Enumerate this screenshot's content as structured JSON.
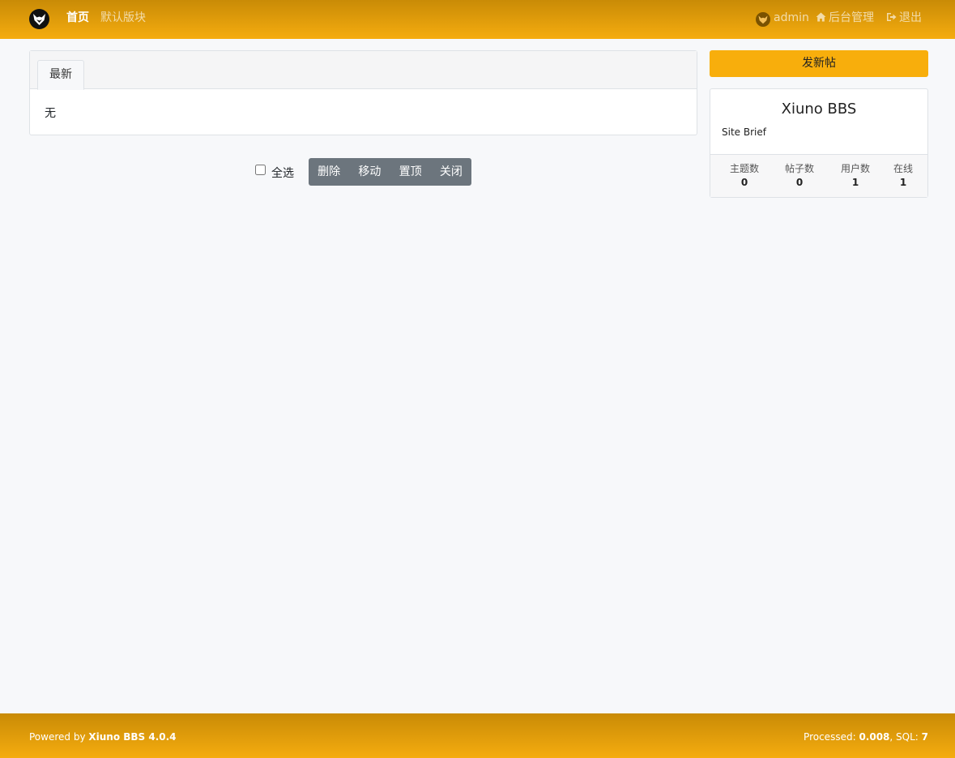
{
  "header": {
    "nav": {
      "home": "首页",
      "default_forum": "默认版块"
    },
    "user": {
      "name": "admin",
      "admin_panel": "后台管理",
      "logout": "退出"
    }
  },
  "main": {
    "tab_latest": "最新",
    "empty_text": "无",
    "moderation": {
      "select_all": "全选",
      "delete": "删除",
      "move": "移动",
      "sticky": "置顶",
      "close": "关闭"
    }
  },
  "sidebar": {
    "new_post": "发新帖",
    "site_name": "Xiuno BBS",
    "site_brief": "Site Brief",
    "stats": [
      {
        "label": "主题数",
        "value": "0"
      },
      {
        "label": "帖子数",
        "value": "0"
      },
      {
        "label": "用户数",
        "value": "1"
      },
      {
        "label": "在线",
        "value": "1"
      }
    ]
  },
  "footer": {
    "powered_prefix": "Powered by ",
    "powered_name": "Xiuno BBS 4.0.4",
    "processed_prefix": "Processed: ",
    "processed_value": "0.008",
    "sql_prefix": ", SQL: ",
    "sql_value": "7"
  },
  "colors": {
    "accent": "#f8ae0c",
    "header_gradient_top": "#c98b06",
    "header_gradient_bottom": "#f5ac0f",
    "button_secondary": "#6c757d"
  },
  "icons": {
    "logo": "fox-logo-icon",
    "avatar": "fox-avatar-icon",
    "admin_panel": "home-icon",
    "logout": "sign-out-icon"
  }
}
